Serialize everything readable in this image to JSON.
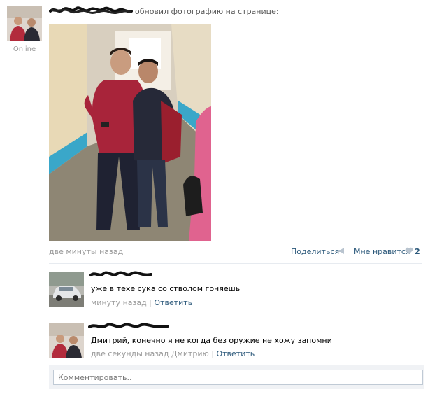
{
  "post": {
    "author_name": "",
    "action_text": "обновил фотографию на странице:",
    "status": "Online",
    "time": "две минуты назад",
    "share_label": "Поделиться",
    "like_label": "Мне нравится",
    "like_count": "2"
  },
  "comments": [
    {
      "author_name": "",
      "text": "уже в техе сука со стволом гоняешь",
      "time": "минуту назад",
      "separator": "|",
      "reply_label": "Ответить"
    },
    {
      "author_name": "",
      "text": "Дмитрий, конечно я не когда без оружие не хожу запомни",
      "time": "две секунды назад Дмитрию",
      "separator": "|",
      "reply_label": "Ответить"
    }
  ],
  "comment_box": {
    "placeholder": "Комментировать.."
  },
  "colors": {
    "link": "#2b587a",
    "muted": "#999999",
    "divider": "#e7ebf0",
    "input_border": "#c0cad5"
  }
}
